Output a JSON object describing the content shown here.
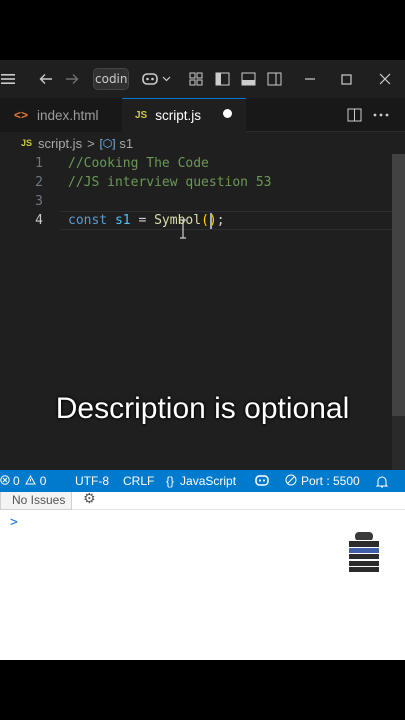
{
  "titlebar": {
    "search_value": "coding"
  },
  "tabs": [
    {
      "label": "index.html"
    },
    {
      "label": "script.js"
    }
  ],
  "breadcrumb": {
    "file": "script.js",
    "separator": ">",
    "symbol": "s1"
  },
  "editor": {
    "lines": [
      {
        "number": "1",
        "text": "//Cooking The Code"
      },
      {
        "number": "2",
        "text": "//JS interview question 53"
      },
      {
        "number": "3",
        "text": ""
      },
      {
        "number": "4",
        "keyword": "const",
        "var": "s1",
        "op": "=",
        "func": "Symbol",
        "open_paren": "(",
        "close_paren": ")",
        "semicolon": ";"
      }
    ],
    "current_line": 4
  },
  "caption": "Description is optional",
  "statusbar": {
    "errors": "0",
    "warnings": "0",
    "encoding": "UTF-8",
    "line_ending": "CRLF",
    "braces": "{}",
    "language": "JavaScript",
    "port": "Port : 5500"
  },
  "panel": {
    "no_issues": "No Issues",
    "prompt": ">"
  },
  "colors": {
    "statusbar_bg": "#007acc",
    "editor_bg": "#1f1f1f",
    "comment": "#6a9955",
    "keyword": "#569cd6",
    "function": "#dcdcaa",
    "accent": "#0078d4"
  },
  "icons": [
    "menu-icon",
    "back-arrow-icon",
    "forward-arrow-icon",
    "copilot-icon",
    "chevron-down-icon",
    "layout-customize-icon",
    "toggle-sidebar-icon",
    "toggle-panel-icon",
    "toggle-secondary-sidebar-icon",
    "minimize-icon",
    "maximize-icon",
    "close-icon",
    "html-file-icon",
    "js-file-icon",
    "split-editor-icon",
    "more-actions-icon",
    "symbol-variable-icon",
    "error-icon",
    "warning-icon",
    "copilot-status-icon",
    "port-icon",
    "bell-icon",
    "gear-icon"
  ]
}
